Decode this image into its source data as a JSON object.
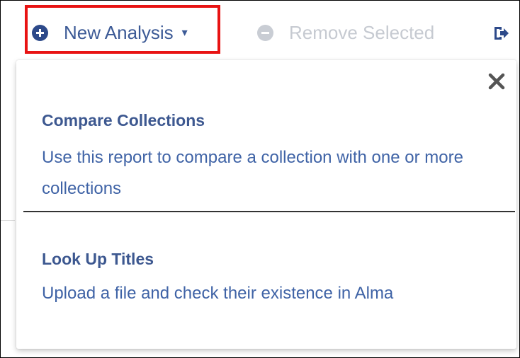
{
  "toolbar": {
    "new_analysis_label": "New Analysis",
    "new_analysis_icon": "plus-circle-icon",
    "caret_glyph": "▾",
    "remove_selected_label": "Remove Selected",
    "remove_selected_icon": "minus-circle-icon",
    "export_icon": "export-icon"
  },
  "dropdown": {
    "close_icon": "close-icon",
    "options": [
      {
        "title": "Compare Collections",
        "description": "Use this report to compare a collection with one or more collections"
      },
      {
        "title": "Look Up Titles",
        "description": "Upload a file and check their existence in Alma"
      }
    ]
  },
  "colors": {
    "primary": "#3c5a96",
    "highlight": "#e81313",
    "disabled": "#c6cad1"
  }
}
